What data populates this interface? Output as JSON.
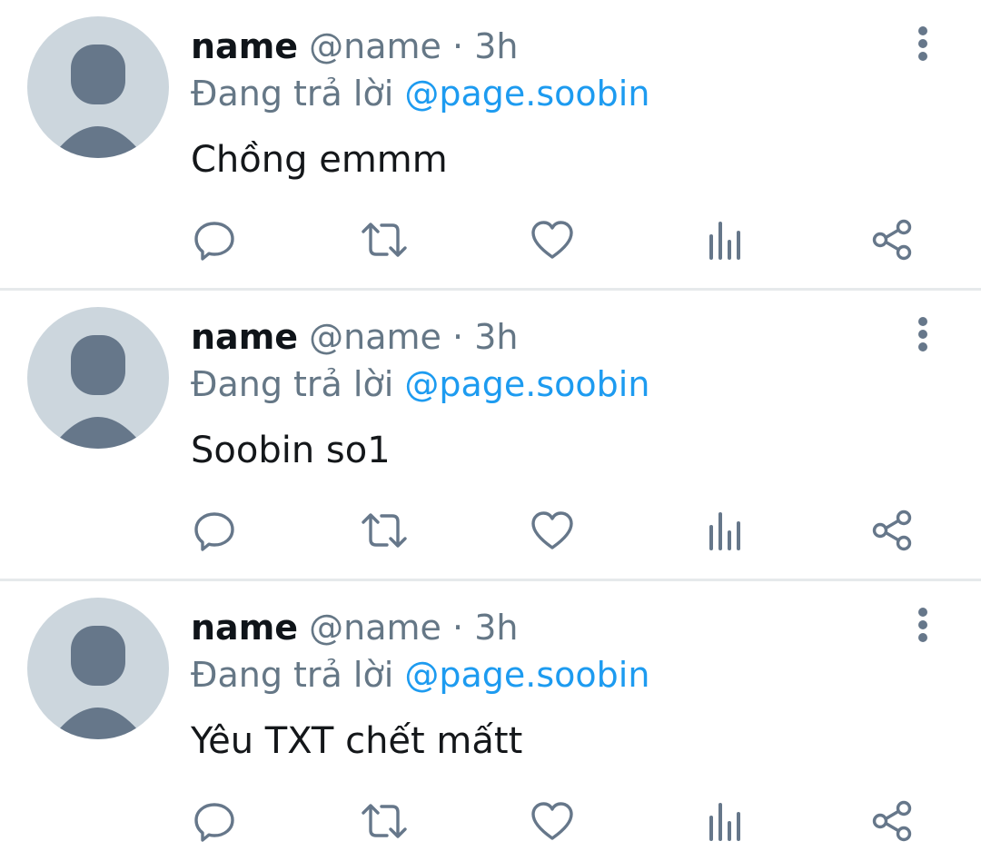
{
  "colors": {
    "avatar_bg": "#ccd6dd",
    "avatar_fg": "#66778a",
    "muted_text": "#657786",
    "mention": "#1d9bf0",
    "icon": "#66778a",
    "divider": "#e6e9eb"
  },
  "icons": {
    "more": "vertical-dots-icon",
    "reply": "speech-bubble-icon",
    "retweet": "retweet-arrows-icon",
    "like": "heart-icon",
    "views": "bar-chart-icon",
    "share": "share-nodes-icon"
  },
  "tweets": [
    {
      "display_name": "name",
      "handle": "@name",
      "separator": "·",
      "time": "3h",
      "reply_prefix": "Đang trả lời",
      "reply_to": "@page.soobin",
      "text": "Chồng emmm"
    },
    {
      "display_name": "name",
      "handle": "@name",
      "separator": "·",
      "time": "3h",
      "reply_prefix": "Đang trả lời",
      "reply_to": "@page.soobin",
      "text": "Soobin so1"
    },
    {
      "display_name": "name",
      "handle": "@name",
      "separator": "·",
      "time": "3h",
      "reply_prefix": "Đang trả lời",
      "reply_to": "@page.soobin",
      "text": "Yêu TXT chết mấtt"
    }
  ]
}
